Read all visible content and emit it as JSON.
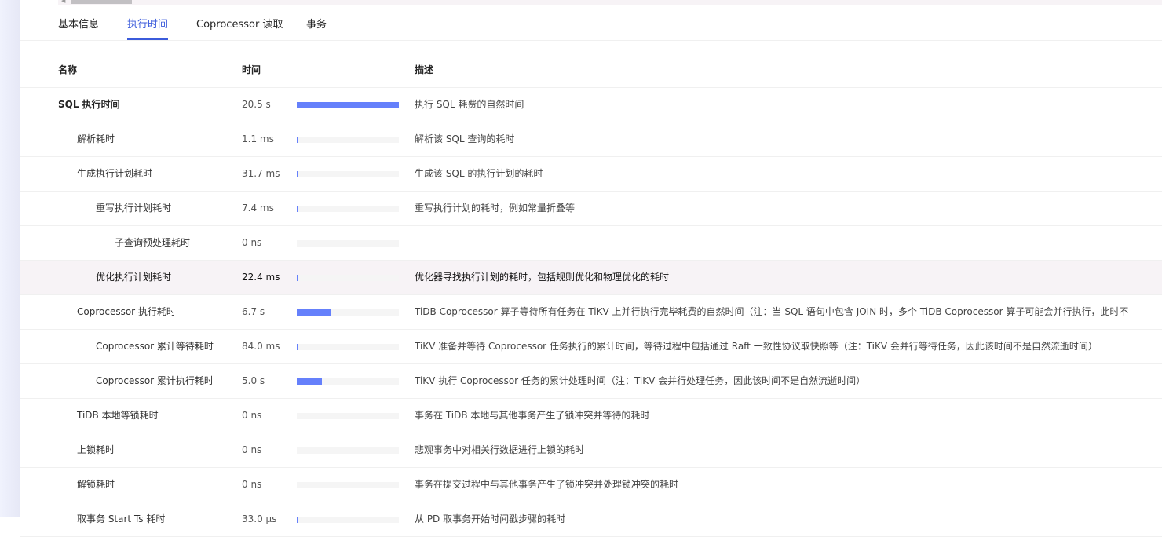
{
  "tabs": [
    {
      "label": "基本信息"
    },
    {
      "label": "执行时间",
      "active": true
    },
    {
      "label": "Coprocessor 读取"
    },
    {
      "label": "事务"
    }
  ],
  "columns": {
    "name": "名称",
    "time": "时间",
    "desc": "描述"
  },
  "colors": {
    "accent": "#3b5bdb",
    "bar": "#6580fb"
  },
  "rows": [
    {
      "name": "SQL 执行时间",
      "time": "20.5 s",
      "fraction": 1.0,
      "desc": "执行 SQL 耗费的自然时间",
      "level": 0,
      "bold": true
    },
    {
      "name": "解析耗时",
      "time": "1.1 ms",
      "fraction": 5e-05,
      "desc": "解析该 SQL 查询的耗时",
      "level": 1
    },
    {
      "name": "生成执行计划耗时",
      "time": "31.7 ms",
      "fraction": 0.0015,
      "desc": "生成该 SQL 的执行计划的耗时",
      "level": 1
    },
    {
      "name": "重写执行计划耗时",
      "time": "7.4 ms",
      "fraction": 0.0004,
      "desc": "重写执行计划的耗时，例如常量折叠等",
      "level": 2
    },
    {
      "name": "子查询预处理耗时",
      "time": "0 ns",
      "fraction": 0,
      "desc": "",
      "level": 3
    },
    {
      "name": "优化执行计划耗时",
      "time": "22.4 ms",
      "fraction": 0.0011,
      "desc": "优化器寻找执行计划的耗时，包括规则优化和物理优化的耗时",
      "level": 2,
      "highlight": true
    },
    {
      "name": "Coprocessor 执行耗时",
      "time": "6.7 s",
      "fraction": 0.33,
      "desc": "TiDB Coprocessor 算子等待所有任务在 TiKV 上并行执行完毕耗费的自然时间（注：当 SQL 语句中包含 JOIN 时，多个 TiDB Coprocessor 算子可能会并行执行，此时不",
      "level": 1
    },
    {
      "name": "Coprocessor 累计等待耗时",
      "time": "84.0 ms",
      "fraction": 0.004,
      "desc": "TiKV 准备并等待 Coprocessor 任务执行的累计时间，等待过程中包括通过 Raft 一致性协议取快照等（注：TiKV 会并行等待任务，因此该时间不是自然流逝时间）",
      "level": 2
    },
    {
      "name": "Coprocessor 累计执行耗时",
      "time": "5.0 s",
      "fraction": 0.244,
      "desc": "TiKV 执行 Coprocessor 任务的累计处理时间（注：TiKV 会并行处理任务，因此该时间不是自然流逝时间）",
      "level": 2
    },
    {
      "name": "TiDB 本地等锁耗时",
      "time": "0 ns",
      "fraction": 0,
      "desc": "事务在 TiDB 本地与其他事务产生了锁冲突并等待的耗时",
      "level": 1
    },
    {
      "name": "上锁耗时",
      "time": "0 ns",
      "fraction": 0,
      "desc": "悲观事务中对相关行数据进行上锁的耗时",
      "level": 1
    },
    {
      "name": "解锁耗时",
      "time": "0 ns",
      "fraction": 0,
      "desc": "事务在提交过程中与其他事务产生了锁冲突并处理锁冲突的耗时",
      "level": 1
    },
    {
      "name": "取事务 Start Ts 耗时",
      "time": "33.0 µs",
      "fraction": 1.6e-06,
      "desc": "从 PD 取事务开始时间戳步骤的耗时",
      "level": 1
    }
  ]
}
